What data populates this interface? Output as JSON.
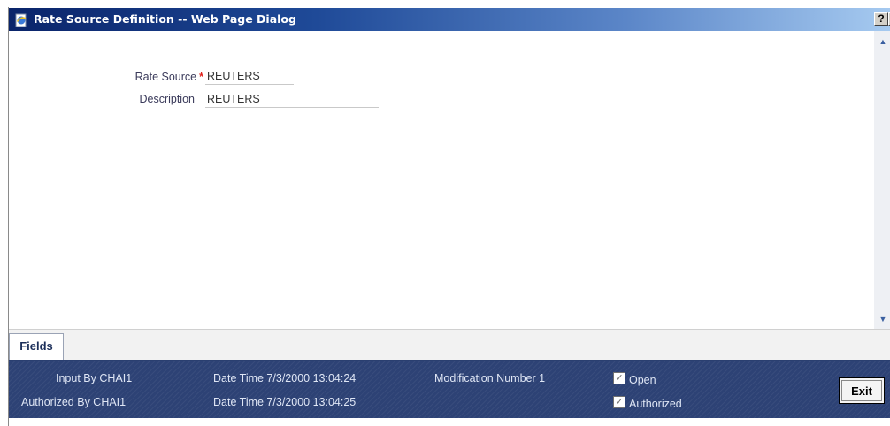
{
  "window": {
    "title": "Rate Source Definition -- Web Page Dialog",
    "help_label": "?",
    "close_label": "✕",
    "icon": "ie-page-icon"
  },
  "form": {
    "rate_source_label": "Rate Source",
    "required_mark": "*",
    "rate_source_value": "REUTERS",
    "description_label": "Description",
    "description_value": "REUTERS"
  },
  "scrollbar": {
    "up": "▲",
    "down": "▼"
  },
  "tabs": [
    {
      "label": "Fields"
    }
  ],
  "audit": {
    "input_by": "Input By CHAI1",
    "authorized_by": "Authorized By CHAI1",
    "input_datetime": "Date Time 7/3/2000 13:04:24",
    "auth_datetime": "Date Time 7/3/2000 13:04:25",
    "modification_number": "Modification Number 1",
    "open_label": "Open",
    "open_checked": true,
    "authorized_label": "Authorized",
    "authorized_checked": true,
    "check_mark": "✓",
    "exit_label": "Exit"
  },
  "colors": {
    "titlebar_start": "#0a246a",
    "titlebar_end": "#a6caf0",
    "audit_bg": "#2d4275",
    "required": "#e0201b"
  }
}
